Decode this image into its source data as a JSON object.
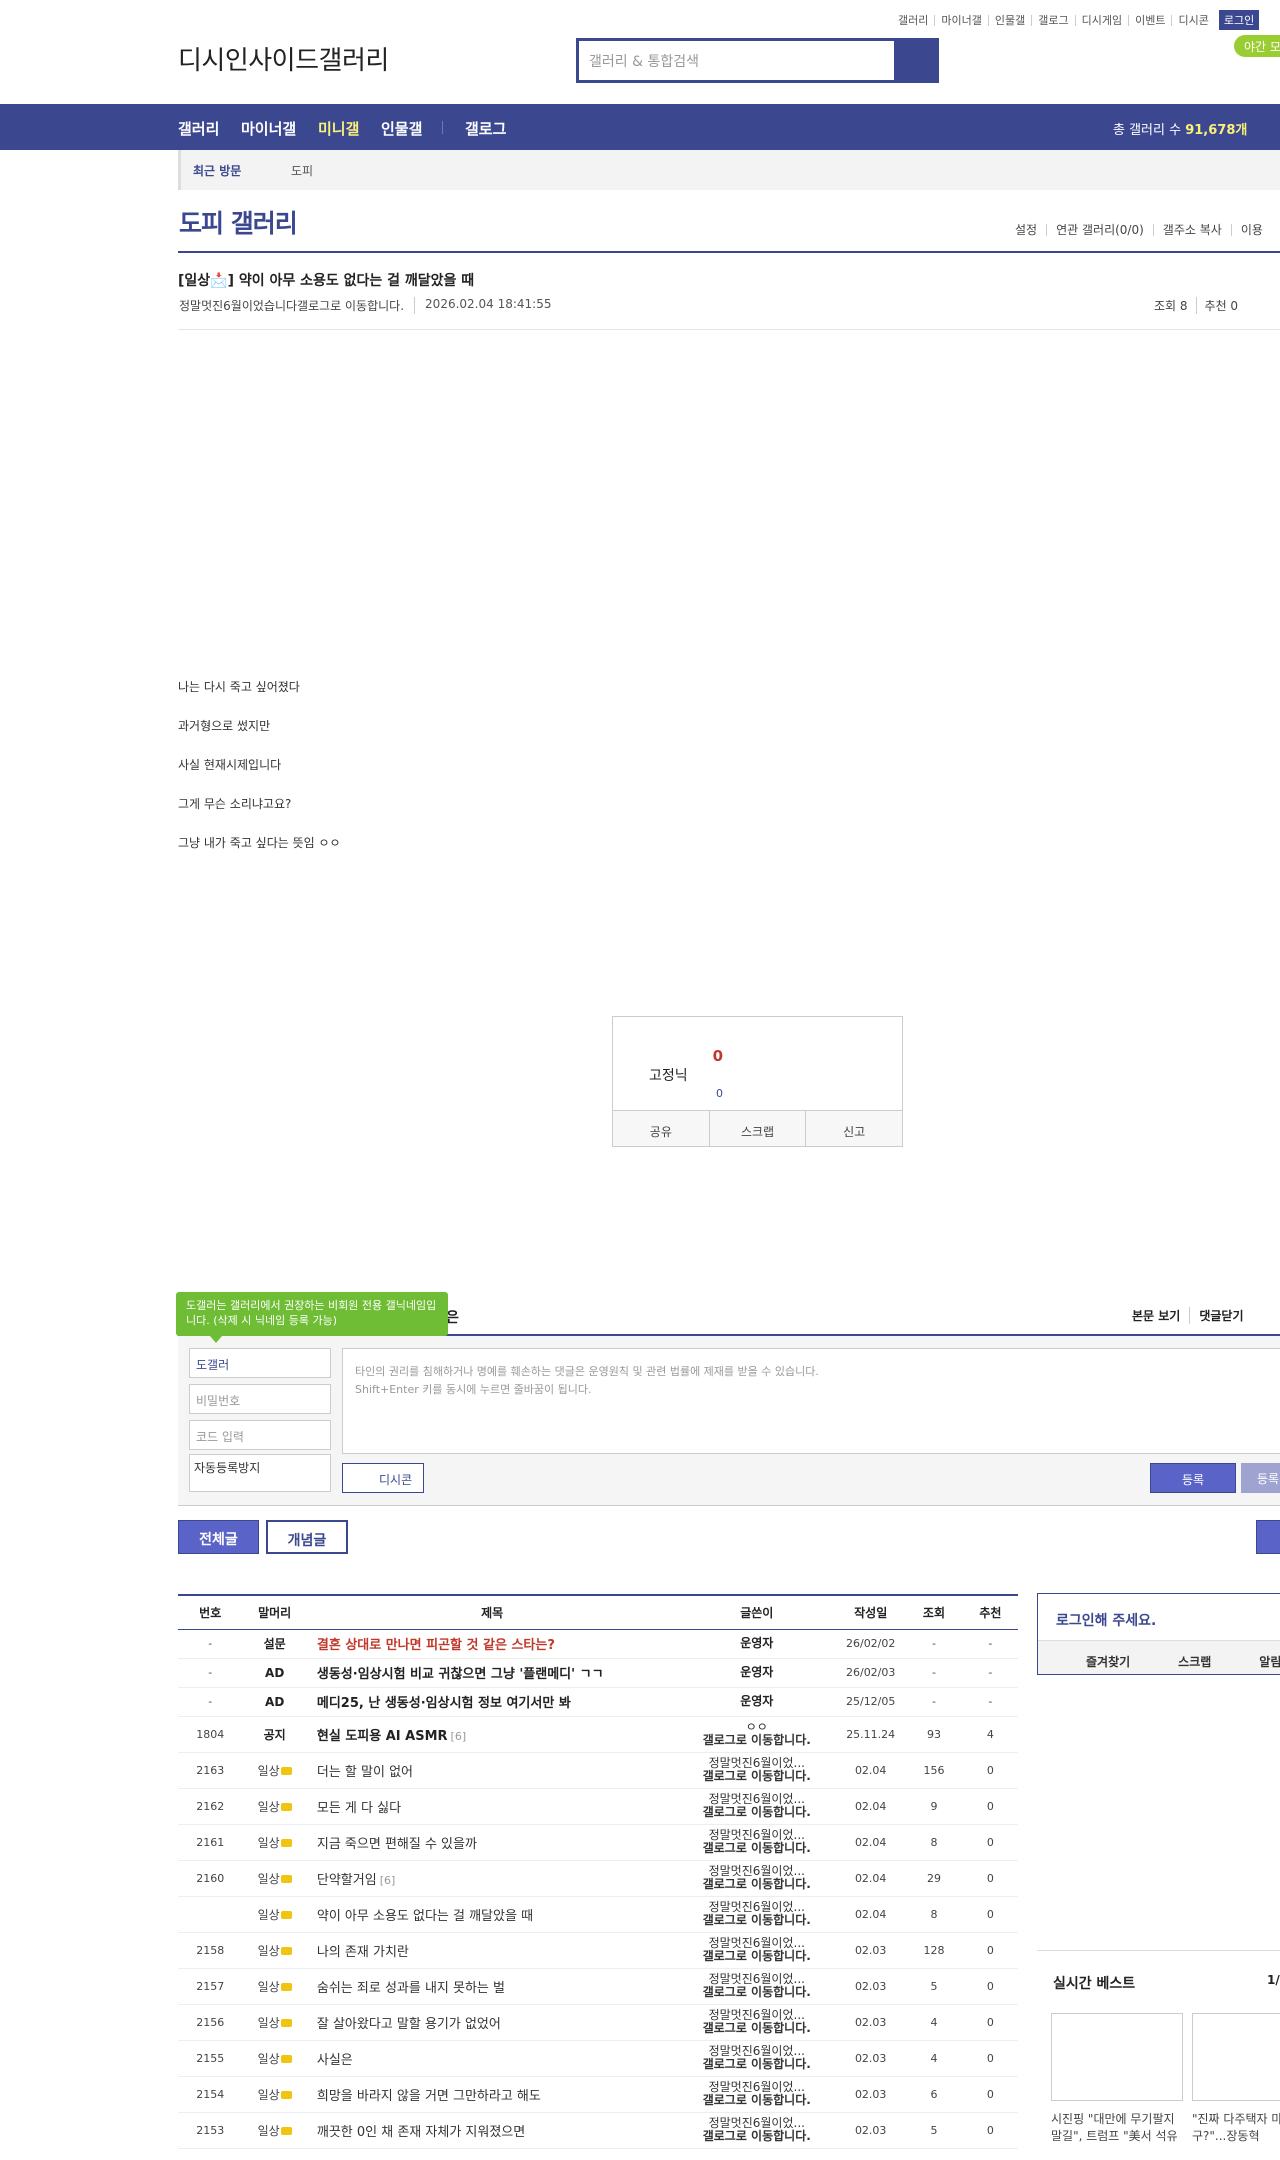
{
  "top_links": [
    "갤러리",
    "마이너갤",
    "인물갤",
    "갤로그",
    "디시게임",
    "이벤트",
    "디시콘"
  ],
  "login_label": "로그인",
  "logo_alt": "디시인사이드갤러리",
  "search": {
    "placeholder": "갤러리 & 통합검색"
  },
  "night_mode": "야간 모",
  "nav": {
    "items": [
      "갤러리",
      "마이너갤",
      "미니갤",
      "인물갤",
      "갤로그"
    ],
    "active": "미니갤",
    "total_label": "총 갤러리 수 ",
    "total_value": "91,678개"
  },
  "recent": {
    "label": "최근 방문",
    "item": "도피"
  },
  "gallery_title": "도피 갤러리",
  "gallery_tools": [
    "설정",
    "연관 갤러리(0/0)",
    "갤주소 복사",
    "이용"
  ],
  "post": {
    "title": "[일상📩] 약이 아무 소용도 없다는 걸 깨달았을 때",
    "writer": "정말멋진6월이었습니다",
    "writer_badge": "갤로그로 이동합니다.",
    "date": "2026.02.04 18:41:55",
    "views": "조회 8",
    "recommends": "추천 0",
    "body": [
      "나는 다시 죽고 싶어졌다",
      "과거형으로 썼지만",
      "사실 현재시제입니다",
      "그게 무슨 소리냐고요?",
      "그냥 내가 죽고 싶다는 뜻임 ㅇㅇ"
    ]
  },
  "recommend": {
    "count": "0",
    "image_label": "고정닉",
    "fixed_count": "0",
    "buttons": [
      "공유",
      "스크랩",
      "신고"
    ]
  },
  "comment": {
    "tooltip": "도갤러는 갤러리에서 권장하는 비회원 전용 갤닉네임입니다. (삭제 시 닉네임 등록 가능)",
    "title_tail": "은",
    "options": [
      "본문 보기",
      "댓글닫기"
    ],
    "nick": "도갤러",
    "password_placeholder": "비밀번호",
    "code_placeholder": "코드 입력",
    "captcha_alt": "자동등록방지",
    "textarea_placeholder": "타인의 권리를 침해하거나 명예를 훼손하는 댓글은 운영원칙 및 관련 법률에 제재를 받을 수 있습니다.\nShift+Enter 키를 동시에 누르면 줄바꿈이 됩니다.",
    "dccon": "디시콘",
    "submit": "등록",
    "submit2": "등록"
  },
  "tabs": {
    "all": "전체글",
    "concept": "개념글"
  },
  "list": {
    "headers": [
      "번호",
      "말머리",
      "제목",
      "글쓴이",
      "작성일",
      "조회",
      "추천"
    ],
    "rows": [
      {
        "no": "-",
        "subj": "설문",
        "title": "결혼 상대로 만나면 피곤할 것 같은 스타는?",
        "cnt": "",
        "writer": "운영자",
        "writer2": "",
        "date": "26/02/02",
        "views": "-",
        "rec": "-",
        "type": "notice-red"
      },
      {
        "no": "-",
        "subj": "AD",
        "title": "생동성·임상시험 비교 귀찮으면 그냥 '플랜메디' ㄱㄱ",
        "cnt": "",
        "writer": "운영자",
        "writer2": "",
        "date": "26/02/03",
        "views": "-",
        "rec": "-",
        "type": "ad"
      },
      {
        "no": "-",
        "subj": "AD",
        "title": "메디25, 난 생동성·임상시험 정보 여기서만 봐",
        "cnt": "",
        "writer": "운영자",
        "writer2": "",
        "date": "25/12/05",
        "views": "-",
        "rec": "-",
        "type": "ad"
      },
      {
        "no": "1804",
        "subj": "공지",
        "title": "현실 도피용 AI ASMR",
        "cnt": "[6]",
        "writer": "ㅇㅇ",
        "writer2": "갤로그로 이동합니다.",
        "date": "25.11.24",
        "views": "93",
        "rec": "4",
        "type": "notice"
      },
      {
        "no": "2163",
        "subj": "일상",
        "title": "더는 할 말이 없어",
        "cnt": "",
        "writer": "정말멋진6월이었...",
        "writer2": "갤로그로 이동합니다.",
        "date": "02.04",
        "views": "156",
        "rec": "0",
        "type": "normal"
      },
      {
        "no": "2162",
        "subj": "일상",
        "title": "모든 게 다 싫다",
        "cnt": "",
        "writer": "정말멋진6월이었...",
        "writer2": "갤로그로 이동합니다.",
        "date": "02.04",
        "views": "9",
        "rec": "0",
        "type": "normal"
      },
      {
        "no": "2161",
        "subj": "일상",
        "title": "지금 죽으면 편해질 수 있을까",
        "cnt": "",
        "writer": "정말멋진6월이었...",
        "writer2": "갤로그로 이동합니다.",
        "date": "02.04",
        "views": "8",
        "rec": "0",
        "type": "normal"
      },
      {
        "no": "2160",
        "subj": "일상",
        "title": "단약할거임",
        "cnt": "[6]",
        "writer": "정말멋진6월이었...",
        "writer2": "갤로그로 이동합니다.",
        "date": "02.04",
        "views": "29",
        "rec": "0",
        "type": "normal"
      },
      {
        "no": "",
        "subj": "일상",
        "title": "약이 아무 소용도 없다는 걸 깨달았을 때",
        "cnt": "",
        "writer": "정말멋진6월이었...",
        "writer2": "갤로그로 이동합니다.",
        "date": "02.04",
        "views": "8",
        "rec": "0",
        "type": "normal"
      },
      {
        "no": "2158",
        "subj": "일상",
        "title": "나의 존재 가치란",
        "cnt": "",
        "writer": "정말멋진6월이었...",
        "writer2": "갤로그로 이동합니다.",
        "date": "02.03",
        "views": "128",
        "rec": "0",
        "type": "normal"
      },
      {
        "no": "2157",
        "subj": "일상",
        "title": "숨쉬는 죄로 성과를 내지 못하는 벌",
        "cnt": "",
        "writer": "정말멋진6월이었...",
        "writer2": "갤로그로 이동합니다.",
        "date": "02.03",
        "views": "5",
        "rec": "0",
        "type": "normal"
      },
      {
        "no": "2156",
        "subj": "일상",
        "title": "잘 살아왔다고 말할 용기가 없었어",
        "cnt": "",
        "writer": "정말멋진6월이었...",
        "writer2": "갤로그로 이동합니다.",
        "date": "02.03",
        "views": "4",
        "rec": "0",
        "type": "normal"
      },
      {
        "no": "2155",
        "subj": "일상",
        "title": "사실은",
        "cnt": "",
        "writer": "정말멋진6월이었...",
        "writer2": "갤로그로 이동합니다.",
        "date": "02.03",
        "views": "4",
        "rec": "0",
        "type": "normal"
      },
      {
        "no": "2154",
        "subj": "일상",
        "title": "희망을 바라지 않을 거면 그만하라고 해도",
        "cnt": "",
        "writer": "정말멋진6월이었...",
        "writer2": "갤로그로 이동합니다.",
        "date": "02.03",
        "views": "6",
        "rec": "0",
        "type": "normal"
      },
      {
        "no": "2153",
        "subj": "일상",
        "title": "깨끗한 0인 채 존재 자체가 지워졌으면",
        "cnt": "",
        "writer": "정말멋진6월이었...",
        "writer2": "갤로그로 이동합니다.",
        "date": "02.03",
        "views": "5",
        "rec": "0",
        "type": "normal"
      }
    ]
  },
  "sidebar": {
    "login_prompt": "로그인해 주세요.",
    "login_row": [
      "즐겨찾기",
      "스크랩",
      "알림"
    ],
    "best_title": "실시간 베스트",
    "best_page": "1/",
    "best_items": [
      "시진핑 \"대만에 무기팔지 말길\", 트럼프 \"美서 석유",
      "\"진짜 다주택자 마 누구?\"...장동혁"
    ]
  },
  "colors": {
    "brand": "#3b4890",
    "accent": "#5a63c7",
    "highlight": "#f9f07a",
    "green": "#6ebd34"
  }
}
